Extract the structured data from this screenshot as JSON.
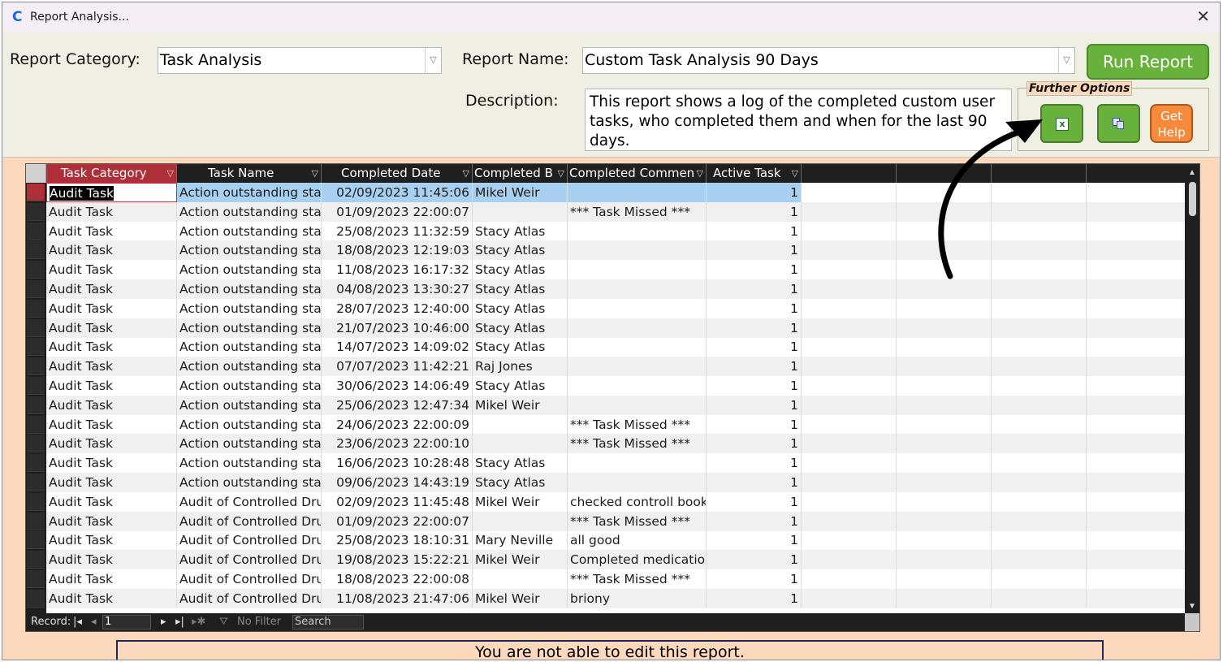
{
  "window": {
    "title": "Report Analysis...",
    "app_icon": "C"
  },
  "form": {
    "category_label": "Report Category:",
    "category_value": "Task Analysis",
    "name_label": "Report Name:",
    "name_value": "Custom Task Analysis 90 Days",
    "run_label": "Run Report",
    "description_label": "Description:",
    "description_text": "This report shows a log of the completed custom user tasks, who completed them and when for the last 90 days.",
    "further_options_label": "Further Options",
    "help_label_1": "Get",
    "help_label_2": "Help"
  },
  "grid": {
    "columns": [
      "Task Category",
      "Task Name",
      "Completed Date",
      "Completed B",
      "Completed Commen",
      "Active Task"
    ],
    "rows": [
      [
        "Audit Task",
        "Action outstanding staff",
        "02/09/2023 11:45:06",
        "Mikel Weir",
        "",
        "1"
      ],
      [
        "Audit Task",
        "Action outstanding staff",
        "01/09/2023 22:00:07",
        "",
        "*** Task Missed ***",
        "1"
      ],
      [
        "Audit Task",
        "Action outstanding staff",
        "25/08/2023 11:32:59",
        "Stacy Atlas",
        "",
        "1"
      ],
      [
        "Audit Task",
        "Action outstanding staff",
        "18/08/2023 12:19:03",
        "Stacy Atlas",
        "",
        "1"
      ],
      [
        "Audit Task",
        "Action outstanding staff",
        "11/08/2023 16:17:32",
        "Stacy Atlas",
        "",
        "1"
      ],
      [
        "Audit Task",
        "Action outstanding staff",
        "04/08/2023 13:30:27",
        "Stacy Atlas",
        "",
        "1"
      ],
      [
        "Audit Task",
        "Action outstanding staff",
        "28/07/2023 12:40:00",
        "Stacy Atlas",
        "",
        "1"
      ],
      [
        "Audit Task",
        "Action outstanding staff",
        "21/07/2023 10:46:00",
        "Stacy Atlas",
        "",
        "1"
      ],
      [
        "Audit Task",
        "Action outstanding staff",
        "14/07/2023 14:09:02",
        "Stacy Atlas",
        "",
        "1"
      ],
      [
        "Audit Task",
        "Action outstanding staff",
        "07/07/2023 11:42:21",
        "Raj Jones",
        "",
        "1"
      ],
      [
        "Audit Task",
        "Action outstanding staff",
        "30/06/2023 14:06:49",
        "Stacy Atlas",
        "",
        "1"
      ],
      [
        "Audit Task",
        "Action outstanding staff",
        "25/06/2023 12:47:34",
        "Mikel Weir",
        "",
        "1"
      ],
      [
        "Audit Task",
        "Action outstanding staff",
        "24/06/2023 22:00:09",
        "",
        "*** Task Missed ***",
        "1"
      ],
      [
        "Audit Task",
        "Action outstanding staff",
        "23/06/2023 22:00:10",
        "",
        "*** Task Missed ***",
        "1"
      ],
      [
        "Audit Task",
        "Action outstanding staff",
        "16/06/2023 10:28:48",
        "Stacy Atlas",
        "",
        "1"
      ],
      [
        "Audit Task",
        "Action outstanding staff",
        "09/06/2023 14:43:19",
        "Stacy Atlas",
        "",
        "1"
      ],
      [
        "Audit Task",
        "Audit of Controlled Drug",
        "02/09/2023 11:45:48",
        "Mikel Weir",
        "checked controll book v",
        "1"
      ],
      [
        "Audit Task",
        "Audit of Controlled Drug",
        "01/09/2023 22:00:07",
        "",
        "*** Task Missed ***",
        "1"
      ],
      [
        "Audit Task",
        "Audit of Controlled Drug",
        "25/08/2023 18:10:31",
        "Mary Neville",
        "all good",
        "1"
      ],
      [
        "Audit Task",
        "Audit of Controlled Drug",
        "19/08/2023 15:22:21",
        "Mikel Weir",
        "Completed medication",
        "1"
      ],
      [
        "Audit Task",
        "Audit of Controlled Drug",
        "18/08/2023 22:00:08",
        "",
        "*** Task Missed ***",
        "1"
      ],
      [
        "Audit Task",
        "Audit of Controlled Drug",
        "11/08/2023 21:47:06",
        "Mikel Weir",
        "briony",
        "1"
      ]
    ]
  },
  "navbar": {
    "record_label": "Record:",
    "record_value": "1",
    "no_filter_label": "No Filter",
    "search_label": "Search"
  },
  "status": {
    "message": "You are not able to edit this report."
  },
  "colors": {
    "accent_green": "#68b13b",
    "accent_orange": "#f68a3a",
    "selected_header": "#ad2f38",
    "window_bg": "#fcd9bd"
  }
}
